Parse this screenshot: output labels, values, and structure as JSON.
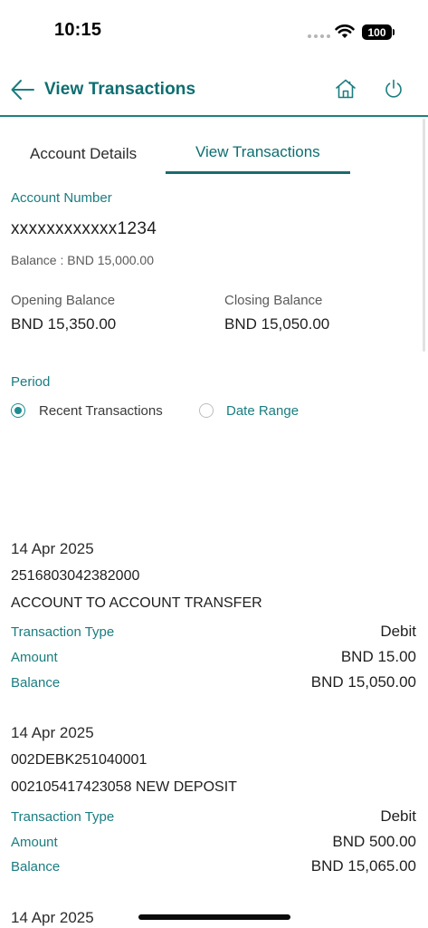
{
  "status_bar": {
    "time": "10:15",
    "battery": "100"
  },
  "header": {
    "title": "View Transactions",
    "icons": [
      "back-arrow-icon",
      "home-icon",
      "power-icon"
    ]
  },
  "tabs": [
    {
      "label": "Account Details",
      "active": false
    },
    {
      "label": "View Transactions",
      "active": true
    }
  ],
  "account": {
    "number_label": "Account Number",
    "number_value": "xxxxxxxxxxxx1234",
    "balance_text": "Balance : BND 15,000.00",
    "opening_label": "Opening Balance",
    "opening_value": "BND 15,350.00",
    "closing_label": "Closing Balance",
    "closing_value": "BND 15,050.00"
  },
  "period": {
    "label": "Period",
    "options": [
      {
        "label": "Recent Transactions",
        "selected": true
      },
      {
        "label": "Date Range",
        "selected": false
      }
    ]
  },
  "transactions": [
    {
      "date": "14 Apr 2025",
      "reference": "2516803042382000",
      "description": "ACCOUNT TO ACCOUNT TRANSFER",
      "type_label": "Transaction Type",
      "type_value": "Debit",
      "amount_label": "Amount",
      "amount_value": "BND 15.00",
      "balance_label": "Balance",
      "balance_value": "BND 15,050.00"
    },
    {
      "date": "14 Apr 2025",
      "reference": "002DEBK251040001",
      "description": "002105417423058 NEW DEPOSIT",
      "type_label": "Transaction Type",
      "type_value": "Debit",
      "amount_label": "Amount",
      "amount_value": "BND 500.00",
      "balance_label": "Balance",
      "balance_value": "BND 15,065.00"
    },
    {
      "date": "14 Apr 2025"
    }
  ],
  "colors": {
    "accent": "#0d6e71",
    "label": "#1a7d80",
    "radio": "#1e8c90"
  }
}
